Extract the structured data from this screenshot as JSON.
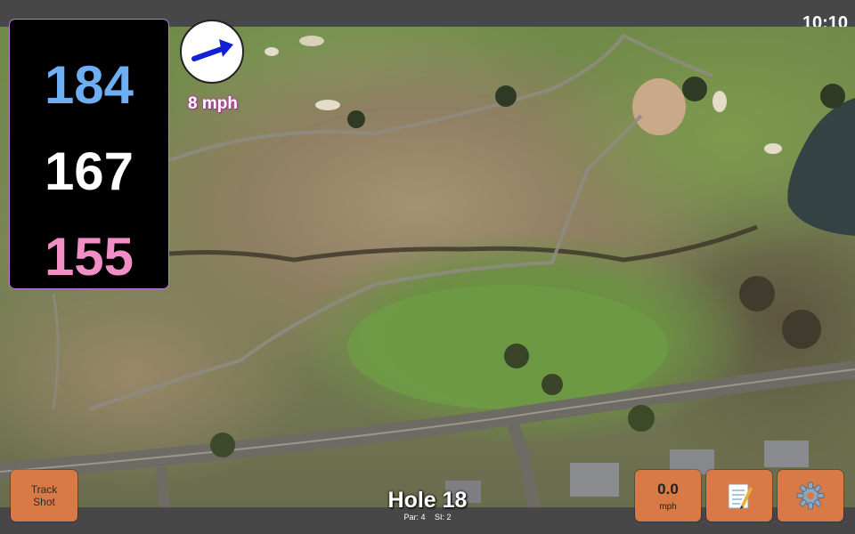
{
  "status": {
    "time": "10:10"
  },
  "yardages": {
    "back": "184",
    "middle": "167",
    "front": "155"
  },
  "wind": {
    "speed_text": "8 mph",
    "direction_icon": "wind-arrow-icon"
  },
  "buttons": {
    "track_shot_line1": "Track",
    "track_shot_line2": "Shot",
    "speed_value": "0.0",
    "speed_unit": "mph",
    "notes_icon": "notepad-icon",
    "settings_icon": "gear-icon"
  },
  "hole": {
    "title": "Hole 18",
    "par": "Par: 4",
    "si": "SI: 2"
  },
  "colors": {
    "back": "#6eaef3",
    "middle": "#ffffff",
    "front": "#f28ec6",
    "button": "#d77a46",
    "wind_text_glow": "#c03ab5"
  }
}
